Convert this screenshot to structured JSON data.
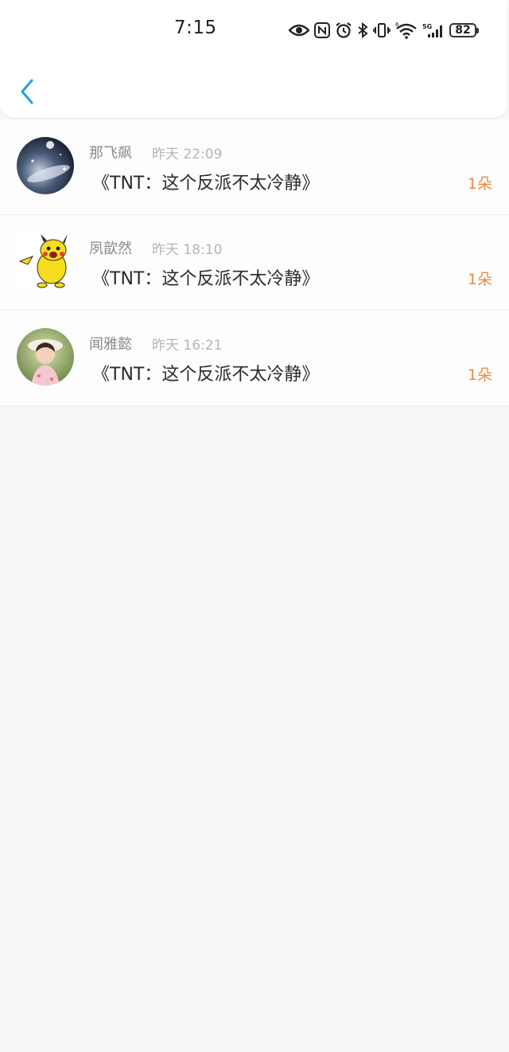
{
  "status_bar": {
    "time": "7:15",
    "battery": "82"
  },
  "header": {
    "back_icon": "chevron-left-icon",
    "accent_color": "#1aa3e8"
  },
  "items": [
    {
      "username": "那飞飙",
      "timestamp": "昨天 22:09",
      "message": "《TNT：这个反派不太冷静》",
      "count": "1朵",
      "avatar": "space-avatar"
    },
    {
      "username": "夙歆然",
      "timestamp": "昨天 18:10",
      "message": "《TNT：这个反派不太冷静》",
      "count": "1朵",
      "avatar": "pikachu-avatar"
    },
    {
      "username": "闻雅懿",
      "timestamp": "昨天 16:21",
      "message": "《TNT：这个反派不太冷静》",
      "count": "1朵",
      "avatar": "girl-photo-avatar"
    }
  ],
  "colors": {
    "count_color": "#f08a45",
    "background": "#f7f6f7"
  }
}
